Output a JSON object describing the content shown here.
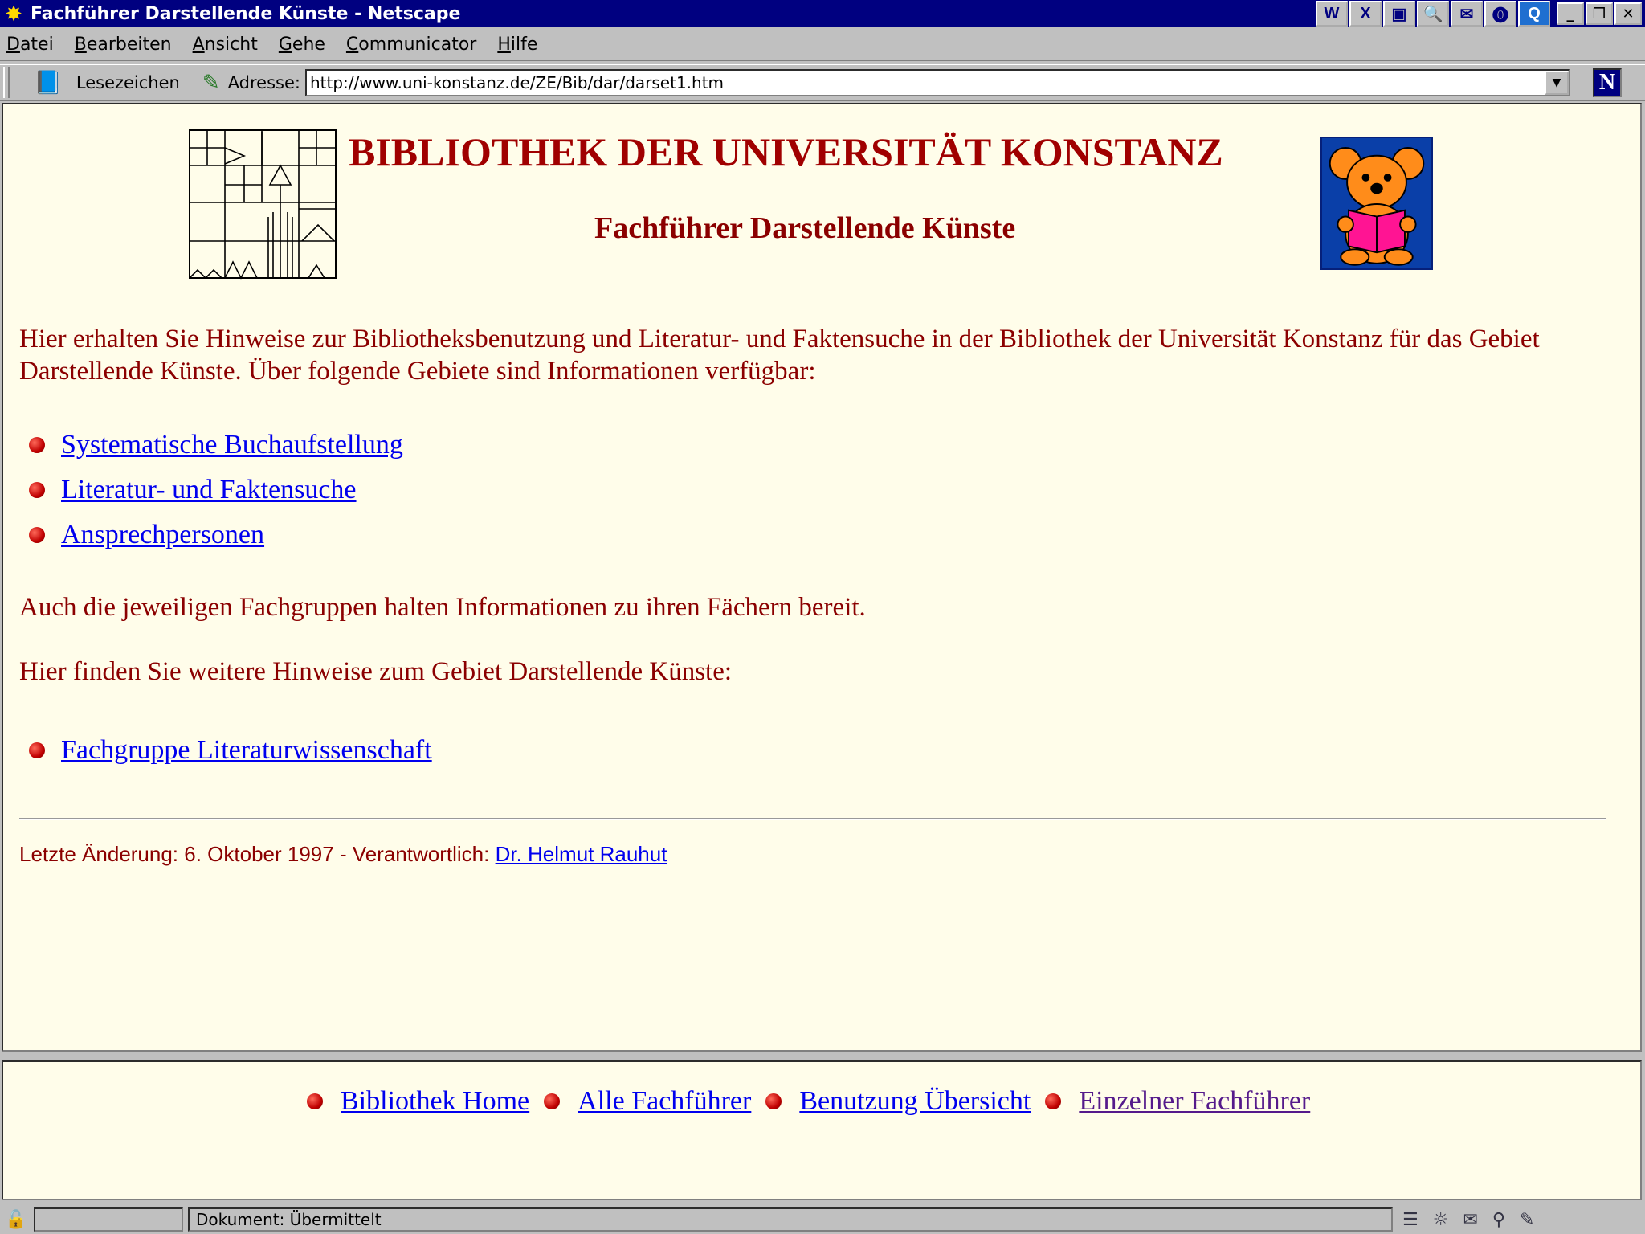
{
  "window": {
    "title": "Fachführer Darstellende Künste - Netscape",
    "minimize": "_",
    "restore": "❐",
    "close": "✕"
  },
  "tray": [
    "W",
    "X",
    "▣",
    "🔍",
    "✉",
    "⓿",
    "Q"
  ],
  "menu": [
    "Datei",
    "Bearbeiten",
    "Ansicht",
    "Gehe",
    "Communicator",
    "Hilfe"
  ],
  "location": {
    "bookmarks_label": "Lesezeichen",
    "address_label": "Adresse:",
    "url": "http://www.uni-konstanz.de/ZE/Bib/dar/darset1.htm"
  },
  "page": {
    "heading": "BIBLIOTHEK DER UNIVERSITÄT KONSTANZ",
    "subheading": "Fachführer Darstellende Künste",
    "intro": "Hier erhalten Sie Hinweise zur Bibliotheksbenutzung und Literatur- und Faktensuche in der Bibliothek der Universität Konstanz für das Gebiet Darstellende Künste. Über folgende Gebiete sind Informationen verfügbar:",
    "topics": [
      "Systematische Buchaufstellung",
      "Literatur- und Faktensuche",
      "Ansprechpersonen"
    ],
    "fachgruppen_note": "Auch die jeweiligen Fachgruppen halten Informationen zu ihren Fächern bereit.",
    "further_note": "Hier finden Sie weitere Hinweise zum Gebiet Darstellende Künste:",
    "further_links": [
      "Fachgruppe Literaturwissenschaft"
    ],
    "last_changed": "Letzte Änderung: 6. Oktober 1997 - Verantwortlich:",
    "responsible": "Dr. Helmut Rauhut"
  },
  "nav": [
    "Bibliothek Home",
    "Alle Fachführer",
    "Benutzung Übersicht",
    "Einzelner Fachführer"
  ],
  "status": {
    "text": "Dokument: Übermittelt"
  },
  "colors": {
    "titlebar": "#000080",
    "page_bg": "#fffdea",
    "text_red": "#8b0000",
    "link": "#0000ee",
    "visited": "#551a8b"
  }
}
